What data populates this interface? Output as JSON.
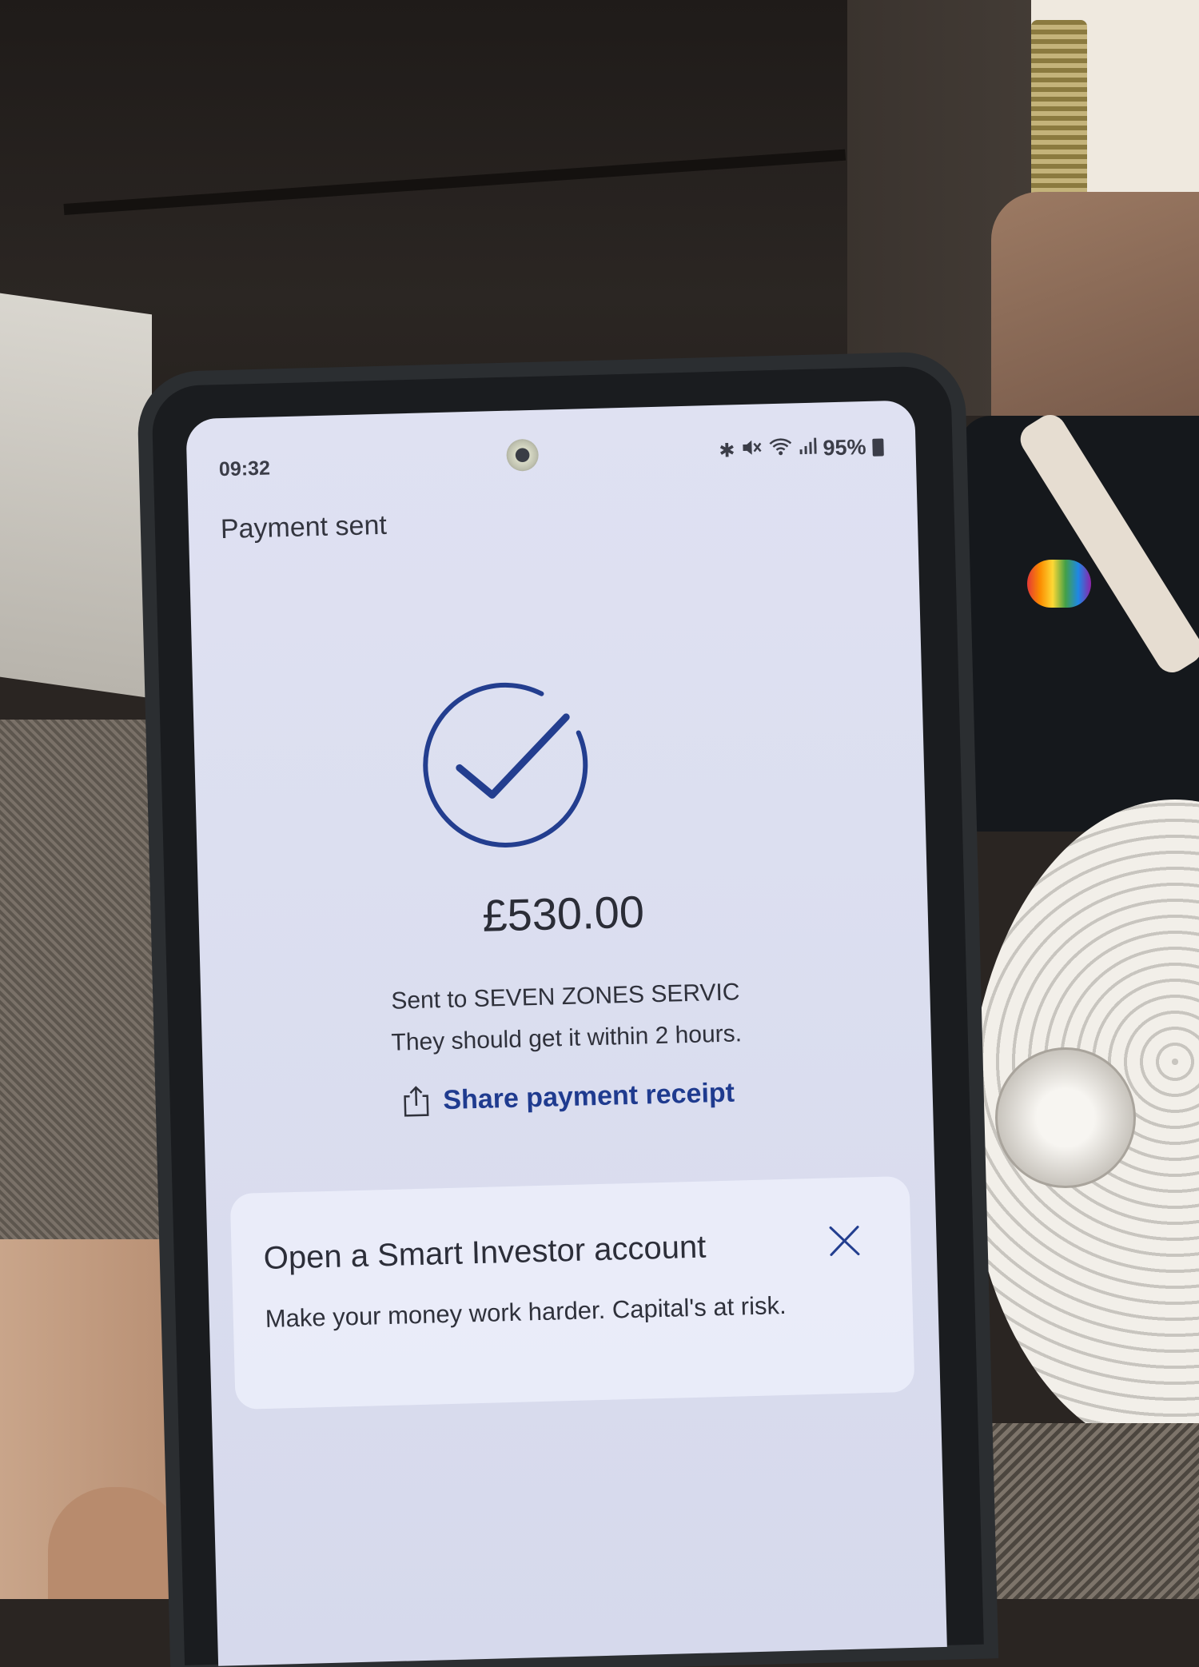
{
  "status_bar": {
    "time": "09:32",
    "battery": "95%",
    "icons": [
      "bluetooth-icon",
      "mute-icon",
      "wifi-icon",
      "signal-icon",
      "battery-icon"
    ]
  },
  "header": {
    "title": "Payment sent"
  },
  "confirmation": {
    "icon": "check-circle-icon",
    "amount": "£530.00",
    "sent_to": "Sent to SEVEN ZONES SERVIC",
    "eta": "They should get it within 2 hours.",
    "share_label": "Share payment receipt",
    "share_icon": "share-icon"
  },
  "promo": {
    "title": "Open a Smart Investor account",
    "subtitle": "Make your money work harder. Capital's at risk.",
    "close_icon": "close-icon"
  },
  "colors": {
    "accent": "#1f3b8f",
    "screen_bg": "#dcdff0"
  }
}
